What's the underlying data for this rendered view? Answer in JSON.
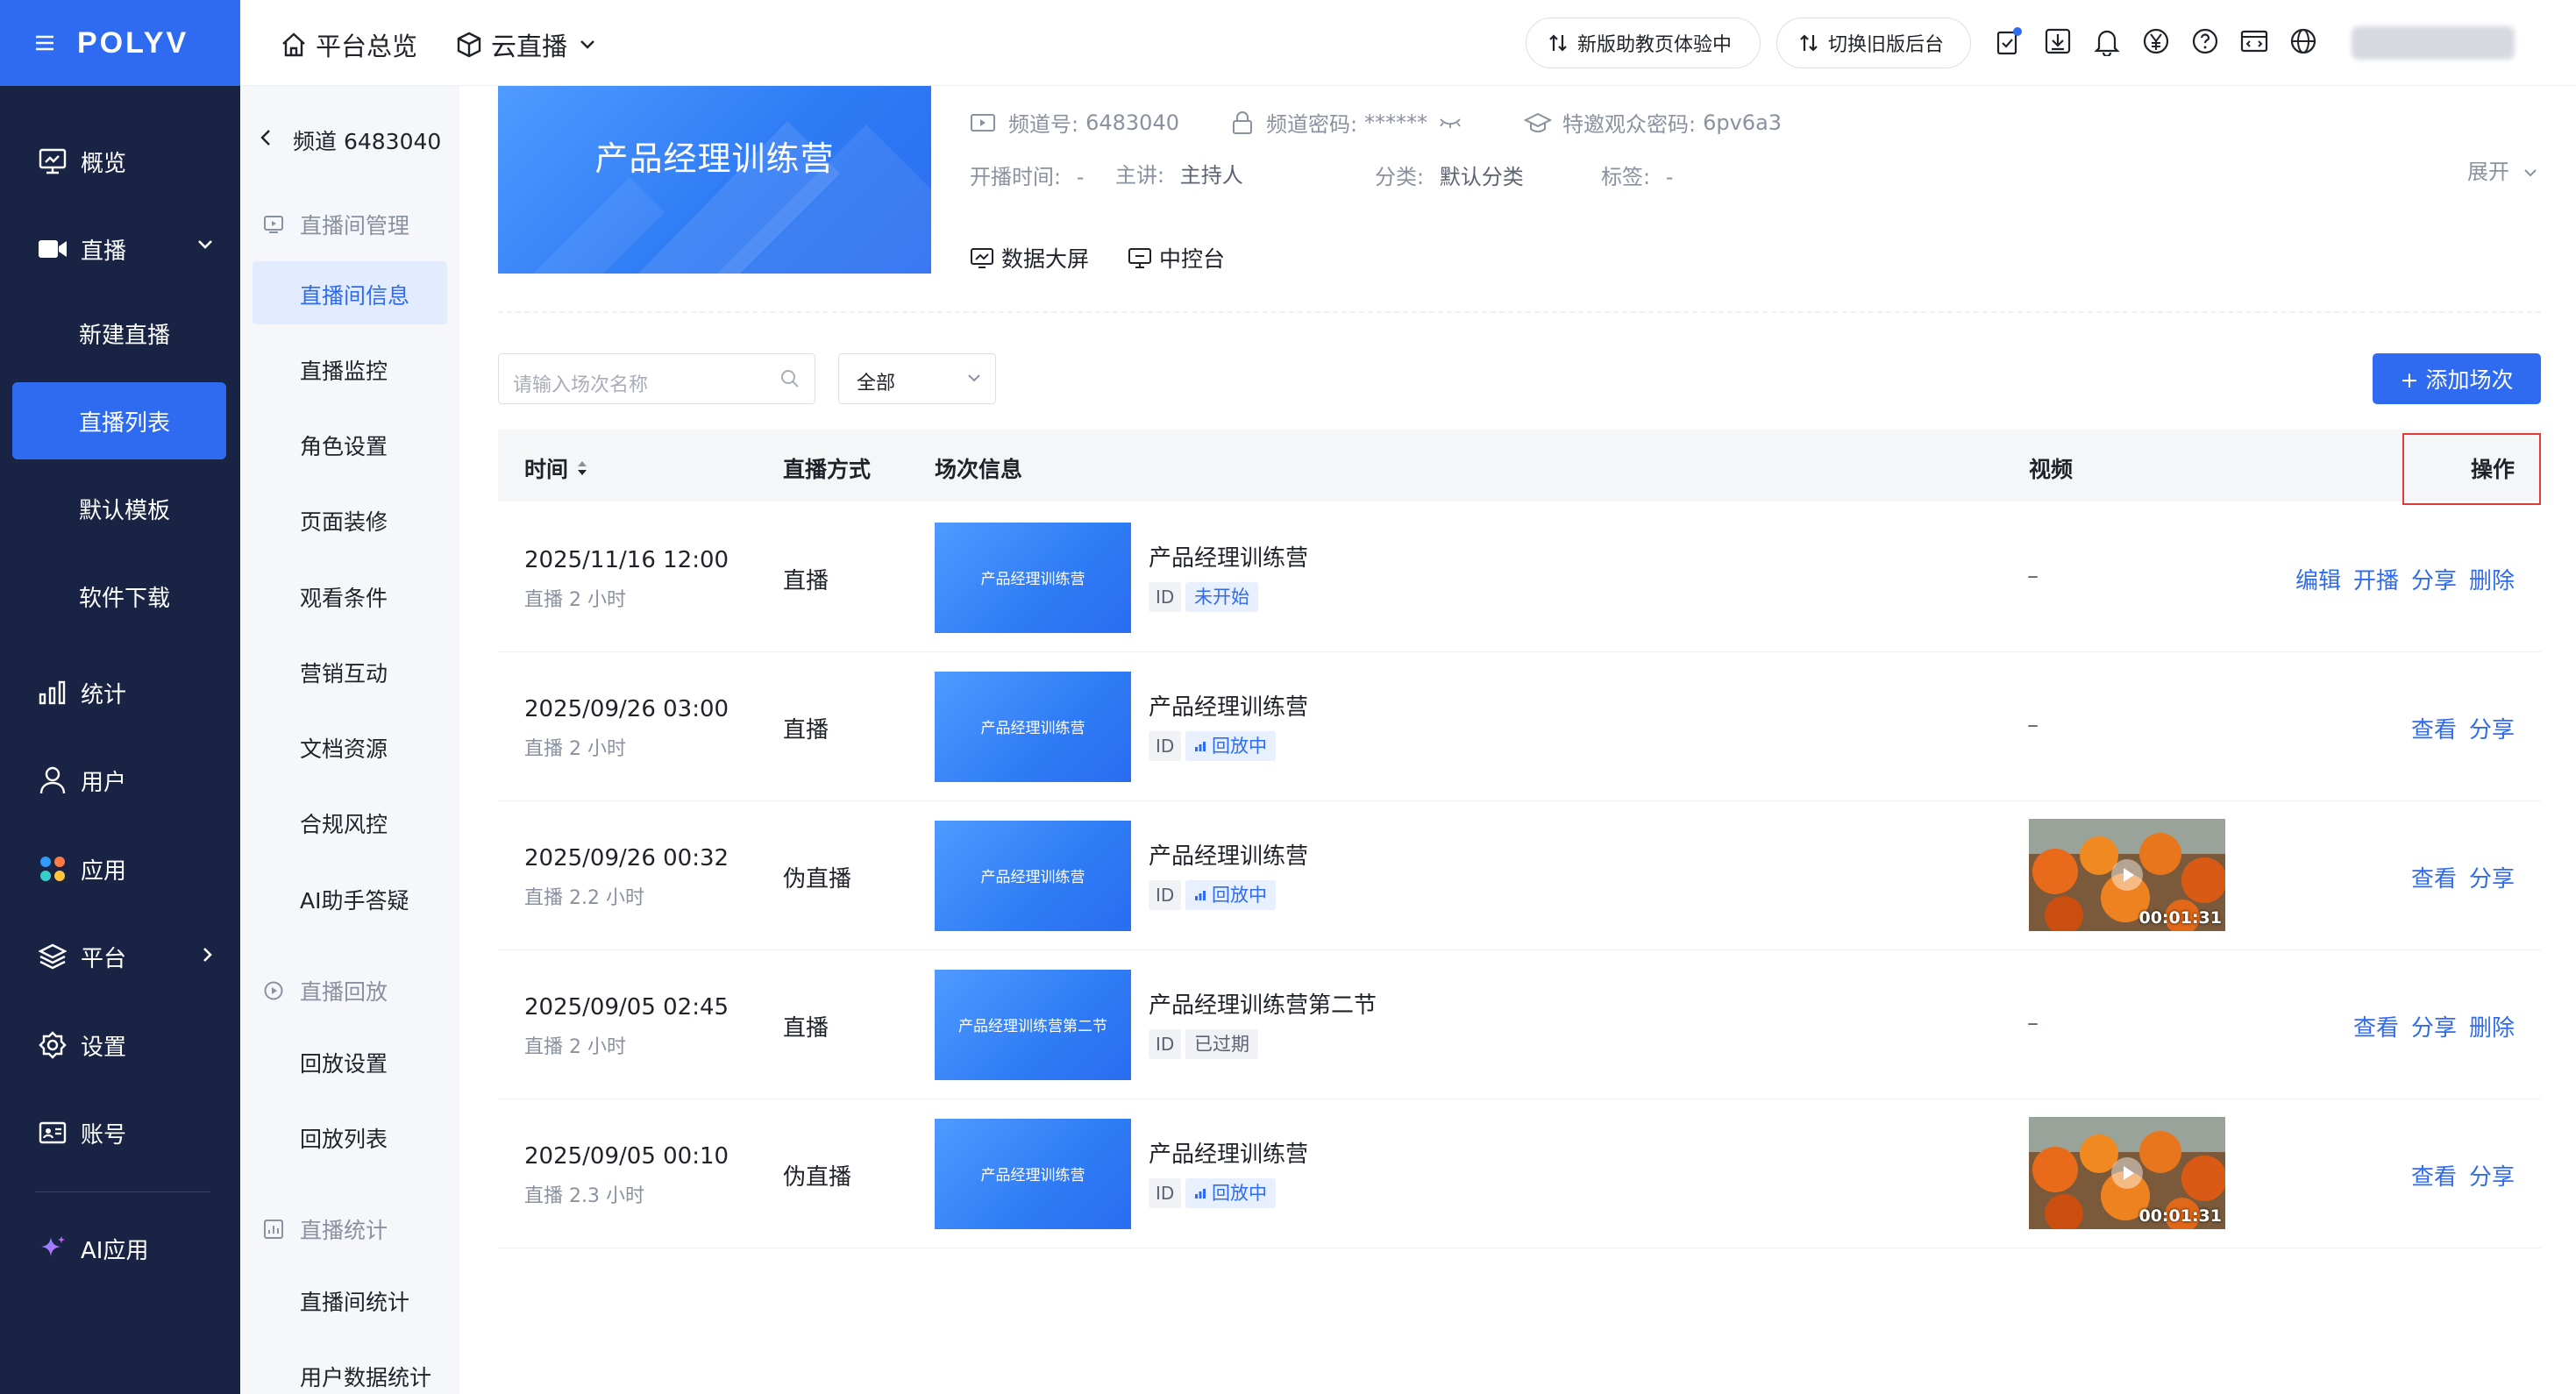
{
  "app": {
    "brand": "POLYV"
  },
  "sidebar": {
    "items": [
      {
        "label": "概览",
        "icon": "monitor-icon"
      },
      {
        "label": "直播",
        "icon": "video-camera-icon"
      },
      {
        "label": "新建直播"
      },
      {
        "label": "直播列表"
      },
      {
        "label": "默认模板"
      },
      {
        "label": "软件下载"
      },
      {
        "label": "统计",
        "icon": "bar-chart-icon"
      },
      {
        "label": "用户",
        "icon": "user-icon"
      },
      {
        "label": "应用",
        "icon": "apps-icon"
      },
      {
        "label": "平台",
        "icon": "layers-icon"
      },
      {
        "label": "设置",
        "icon": "gear-icon"
      },
      {
        "label": "账号",
        "icon": "id-card-icon"
      },
      {
        "label": "AI应用",
        "icon": "sparkle-icon"
      }
    ]
  },
  "topbar": {
    "overview": "平台总览",
    "cloud_live": "云直播",
    "pill_new": "新版助教页体验中",
    "pill_old": "切换旧版后台"
  },
  "subnav": {
    "back_label": "频道 6483040",
    "group1": "直播间管理",
    "items1": [
      "直播间信息",
      "直播监控",
      "角色设置",
      "页面装修",
      "观看条件",
      "营销互动",
      "文档资源",
      "合规风控",
      "AI助手答疑"
    ],
    "group2": "直播回放",
    "items2": [
      "回放设置",
      "回放列表"
    ],
    "group3": "直播统计",
    "items3": [
      "直播间统计",
      "用户数据统计"
    ]
  },
  "channel": {
    "banner_title": "产品经理训练营",
    "channel_no_label": "频道号:",
    "channel_no": "6483040",
    "password_label": "频道密码:",
    "password": "******",
    "invite_label": "特邀观众密码:",
    "invite": "6pv6a3",
    "start_label": "开播时间:",
    "start": "-",
    "host_label": "主讲:",
    "host": "主持人",
    "category_label": "分类:",
    "category": "默认分类",
    "tag_label": "标签:",
    "tag": "-",
    "expand": "展开",
    "data_screen": "数据大屏",
    "control": "中控台"
  },
  "toolbar": {
    "search_placeholder": "请输入场次名称",
    "filter_value": "全部",
    "add_label": "+ 添加场次"
  },
  "table": {
    "headers": {
      "time": "时间",
      "mode": "直播方式",
      "info": "场次信息",
      "video": "视频",
      "ops": "操作"
    },
    "rows": [
      {
        "time": "2025/11/16 12:00",
        "dur": "直播 2 小时",
        "mode": "直播",
        "thumb": "产品经理训练营",
        "name": "产品经理训练营",
        "id": "ID",
        "status": "未开始",
        "video": "–",
        "ops": [
          "编辑",
          "开播",
          "分享",
          "删除"
        ]
      },
      {
        "time": "2025/09/26 03:00",
        "dur": "直播 2 小时",
        "mode": "直播",
        "thumb": "产品经理训练营",
        "name": "产品经理训练营",
        "id": "ID",
        "status": "回放中",
        "video": "–",
        "ops": [
          "查看",
          "分享"
        ]
      },
      {
        "time": "2025/09/26 00:32",
        "dur": "直播 2.2 小时",
        "mode": "伪直播",
        "thumb": "产品经理训练营",
        "name": "产品经理训练营",
        "id": "ID",
        "status": "回放中",
        "video_time": "00:01:31",
        "ops": [
          "查看",
          "分享"
        ]
      },
      {
        "time": "2025/09/05 02:45",
        "dur": "直播 2 小时",
        "mode": "直播",
        "thumb": "产品经理训练营第二节",
        "name": "产品经理训练营第二节",
        "id": "ID",
        "status": "已过期",
        "video": "–",
        "ops": [
          "查看",
          "分享",
          "删除"
        ]
      },
      {
        "time": "2025/09/05 00:10",
        "dur": "直播 2.3 小时",
        "mode": "伪直播",
        "thumb": "产品经理训练营",
        "name": "产品经理训练营",
        "id": "ID",
        "status": "回放中",
        "video_time": "00:01:31",
        "ops": [
          "查看",
          "分享"
        ]
      }
    ]
  },
  "colors": {
    "primary": "#2f6bf0",
    "sidebar": "#192444",
    "highlight_box": "#e03a3a"
  }
}
